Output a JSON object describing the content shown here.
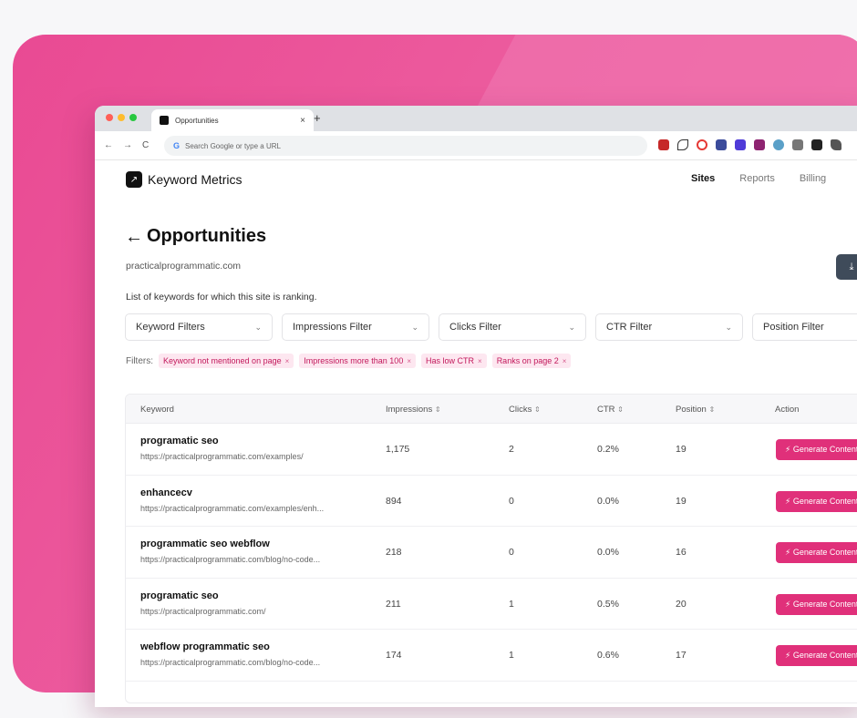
{
  "browser": {
    "tab_title": "Opportunities",
    "tab_close": "×",
    "new_tab": "+",
    "nav_back": "←",
    "nav_forward": "→",
    "nav_reload": "C",
    "omnibox_placeholder": "Search Google or type a URL",
    "google_glyph": "G"
  },
  "app": {
    "brand": "Keyword Metrics",
    "nav": {
      "sites": "Sites",
      "reports": "Reports",
      "billing": "Billing"
    }
  },
  "page": {
    "back_arrow": "←",
    "title": "Opportunities",
    "domain": "practicalprogrammatic.com",
    "description": "List of keywords for which this site is ranking.",
    "download_icon": "⤓"
  },
  "filters": {
    "keyword": "Keyword Filters",
    "impressions": "Impressions Filter",
    "clicks": "Clicks Filter",
    "ctr": "CTR Filter",
    "position": "Position Filter"
  },
  "active_filters": {
    "label": "Filters:",
    "chips": [
      "Keyword not mentioned on page",
      "Impressions more than 100",
      "Has low CTR",
      "Ranks on page 2"
    ]
  },
  "table": {
    "headers": {
      "keyword": "Keyword",
      "impressions": "Impressions",
      "clicks": "Clicks",
      "ctr": "CTR",
      "position": "Position",
      "action": "Action"
    },
    "sort_glyph": "⇕",
    "action_label": "⚡ Generate Content",
    "rows": [
      {
        "keyword": "programatic seo",
        "url": "https://practicalprogrammatic.com/examples/",
        "impressions": "1,175",
        "clicks": "2",
        "ctr": "0.2%",
        "position": "19"
      },
      {
        "keyword": "enhancecv",
        "url": "https://practicalprogrammatic.com/examples/enh...",
        "impressions": "894",
        "clicks": "0",
        "ctr": "0.0%",
        "position": "19"
      },
      {
        "keyword": "programmatic seo webflow",
        "url": "https://practicalprogrammatic.com/blog/no-code...",
        "impressions": "218",
        "clicks": "0",
        "ctr": "0.0%",
        "position": "16"
      },
      {
        "keyword": "programatic seo",
        "url": "https://practicalprogrammatic.com/",
        "impressions": "211",
        "clicks": "1",
        "ctr": "0.5%",
        "position": "20"
      },
      {
        "keyword": "webflow programmatic seo",
        "url": "https://practicalprogrammatic.com/blog/no-code...",
        "impressions": "174",
        "clicks": "1",
        "ctr": "0.6%",
        "position": "17"
      }
    ]
  },
  "colors": {
    "accent": "#e0307a",
    "background_pink": "#ec5a9d",
    "chip_bg": "#fde7f0",
    "chip_text": "#c2185b",
    "traffic_red": "#ff5f57",
    "traffic_yellow": "#febc2e",
    "traffic_green": "#28c840"
  },
  "icons": {
    "window_controls": [
      "close-dot",
      "minimize-dot",
      "maximize-dot"
    ],
    "extensions": [
      "red-ext-icon",
      "scissors-ext-icon",
      "opera-ext-icon",
      "square-ext-icon",
      "d-ext-icon",
      "purple-ext-icon",
      "search-ext-icon",
      "grey-ext-icon",
      "dark-ext-icon",
      "puzzle-icon"
    ]
  }
}
